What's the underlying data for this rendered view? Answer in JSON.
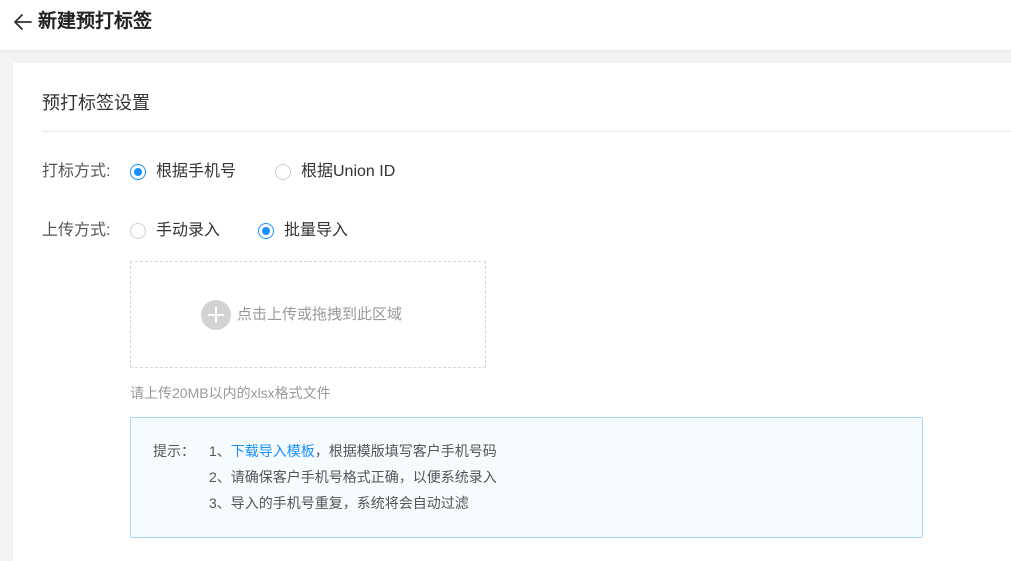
{
  "header": {
    "title": "新建预打标签",
    "back_icon": "arrow-left-icon"
  },
  "section": {
    "title": "预打标签设置"
  },
  "tag_method": {
    "label": "打标方式:",
    "options": [
      {
        "label": "根据手机号",
        "checked": true
      },
      {
        "label": "根据Union ID",
        "checked": false
      }
    ]
  },
  "upload_method": {
    "label": "上传方式:",
    "options": [
      {
        "label": "手动录入",
        "checked": false
      },
      {
        "label": "批量导入",
        "checked": true
      }
    ]
  },
  "upload": {
    "icon": "plus-circle-icon",
    "text": "点击上传或拖拽到此区域",
    "hint": "请上传20MB以内的xlsx格式文件"
  },
  "tips": {
    "label": "提示：",
    "line1_prefix": "1、",
    "line1_link": "下载导入模板",
    "line1_suffix": "，根据模版填写客户手机号码",
    "line2": "2、请确保客户手机号格式正确，以便系统录入",
    "line3": "3、导入的手机号重复，系统将会自动过滤"
  },
  "colors": {
    "accent": "#1890ff",
    "tip_background": "#f5fbff",
    "tip_border": "#a9d6f5"
  }
}
